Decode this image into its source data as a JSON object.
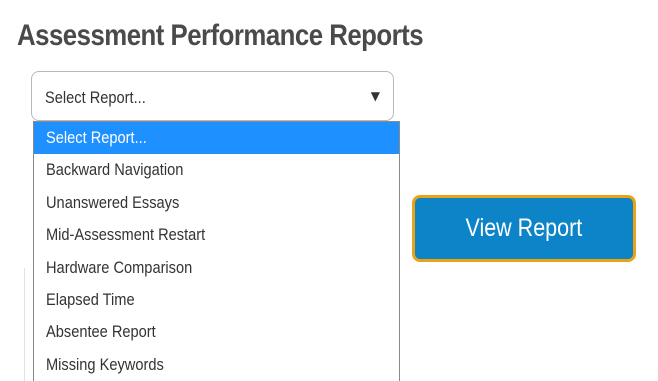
{
  "page": {
    "title": "Assessment Performance Reports"
  },
  "report_select": {
    "selected_value": "Select Report...",
    "arrow_icon": "triangle-down-icon",
    "options": [
      "Select Report...",
      "Backward Navigation",
      "Unanswered Essays",
      "Mid-Assessment Restart",
      "Hardware Comparison",
      "Elapsed Time",
      "Absentee Report",
      "Missing Keywords"
    ],
    "highlighted_index": 0
  },
  "actions": {
    "view_report_label": "View Report"
  },
  "colors": {
    "title": "#4a4a4a",
    "highlight": "#1e90ff",
    "button_fill": "#0d83c8",
    "button_border": "#e8a317"
  }
}
